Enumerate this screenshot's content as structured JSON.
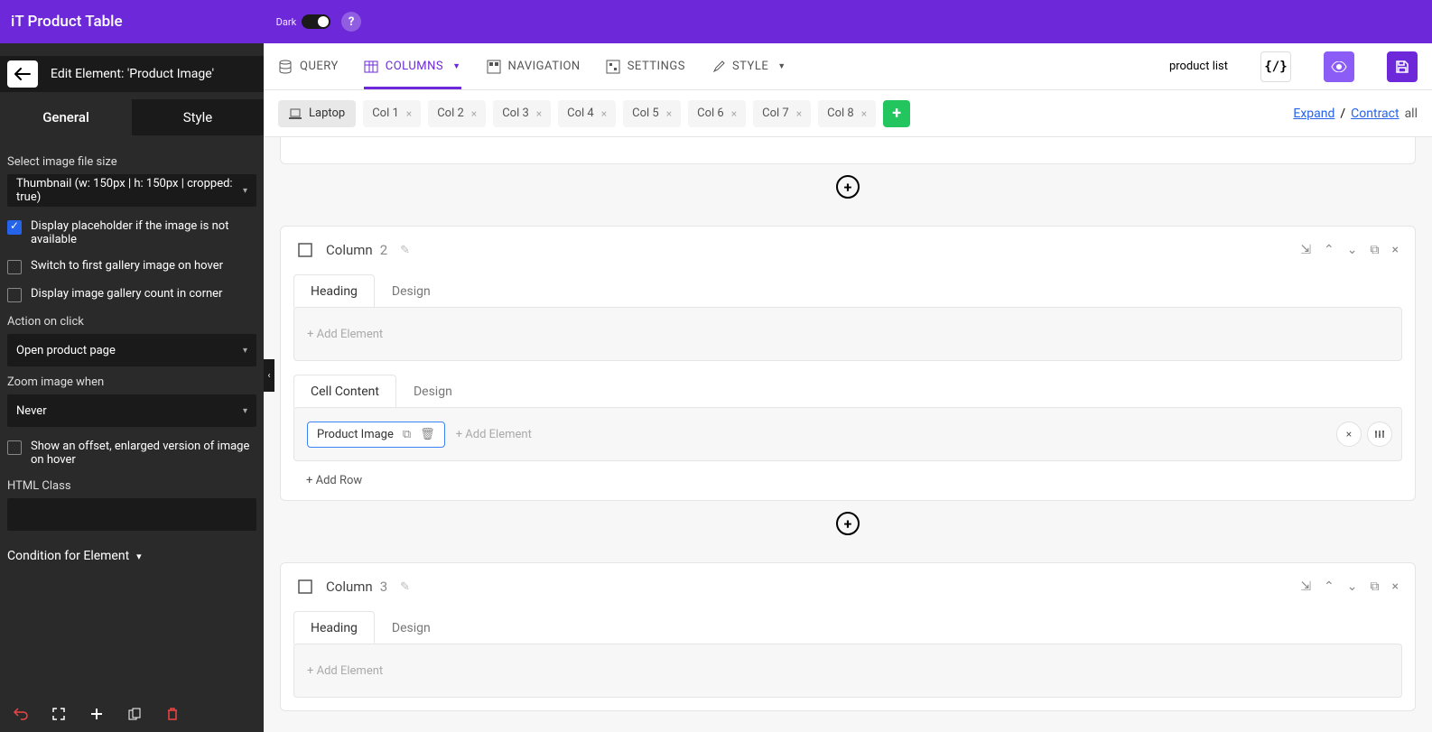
{
  "header": {
    "title": "iT Product Table",
    "dark_label": "Dark",
    "help": "?"
  },
  "sidebar": {
    "edit_title": "Edit Element: 'Product Image'",
    "tab_general": "General",
    "tab_style": "Style",
    "label_image_size": "Select image file size",
    "value_image_size": "Thumbnail (w: 150px | h: 150px | cropped: true)",
    "cb_placeholder": "Display placeholder if the image is not available",
    "cb_hover": "Switch to first gallery image on hover",
    "cb_count": "Display image gallery count in corner",
    "label_action": "Action on click",
    "value_action": "Open product page",
    "label_zoom": "Zoom image when",
    "value_zoom": "Never",
    "cb_offset": "Show an offset, enlarged version of image on hover",
    "label_html": "HTML Class",
    "condition": "Condition for Element"
  },
  "top_nav": {
    "query": "QUERY",
    "columns": "COLUMNS",
    "navigation": "NAVIGATION",
    "settings": "SETTINGS",
    "style": "STYLE",
    "name_value": "product list",
    "code": "{/}"
  },
  "cols_bar": {
    "responsive": "Laptop",
    "cols": [
      "Col 1",
      "Col 2",
      "Col 3",
      "Col 4",
      "Col 5",
      "Col 6",
      "Col 7",
      "Col 8"
    ],
    "expand": "Expand",
    "contract": "Contract",
    "all": "all"
  },
  "col2": {
    "title": "Column",
    "num": "2",
    "tab_heading": "Heading",
    "tab_design": "Design",
    "add_element": "+ Add Element",
    "tab_cell": "Cell Content",
    "chip": "Product Image",
    "add_row": "+ Add Row"
  },
  "col3": {
    "title": "Column",
    "num": "3",
    "tab_heading": "Heading",
    "tab_design": "Design",
    "add_element": "+ Add Element"
  }
}
